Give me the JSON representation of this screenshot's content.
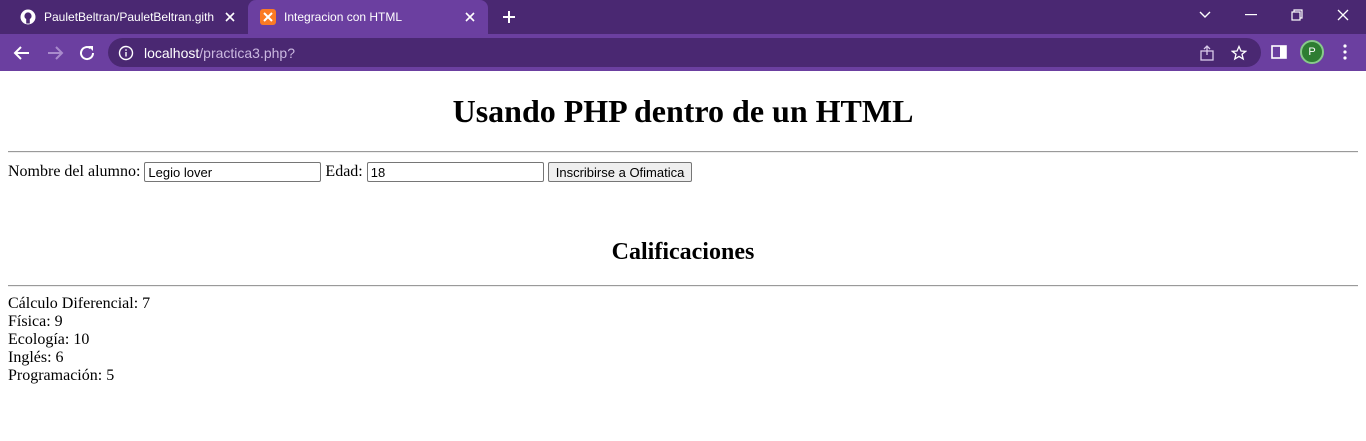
{
  "browser": {
    "tabs": [
      {
        "title": "PauletBeltran/PauletBeltran.githu",
        "active": false,
        "favicon": "github-icon"
      },
      {
        "title": "Integracion con HTML",
        "active": true,
        "favicon": "xampp-icon"
      }
    ],
    "url_host": "localhost",
    "url_path": "/practica3.php?",
    "profile_initial": "P",
    "colors": {
      "frame": "#4a2872",
      "toolbar": "#6b3fa0",
      "avatar": "#2e7d32"
    }
  },
  "page": {
    "heading": "Usando PHP dentro de un HTML",
    "form": {
      "name_label": "Nombre del alumno:",
      "name_value": "Legio lover",
      "age_label": "Edad:",
      "age_value": "18",
      "submit_label": "Inscribirse a Ofimatica"
    },
    "grades_heading": "Calificaciones",
    "grades": [
      "Cálculo Diferencial: 7",
      "Física: 9",
      "Ecología: 10",
      "Inglés: 6",
      "Programación: 5"
    ]
  }
}
